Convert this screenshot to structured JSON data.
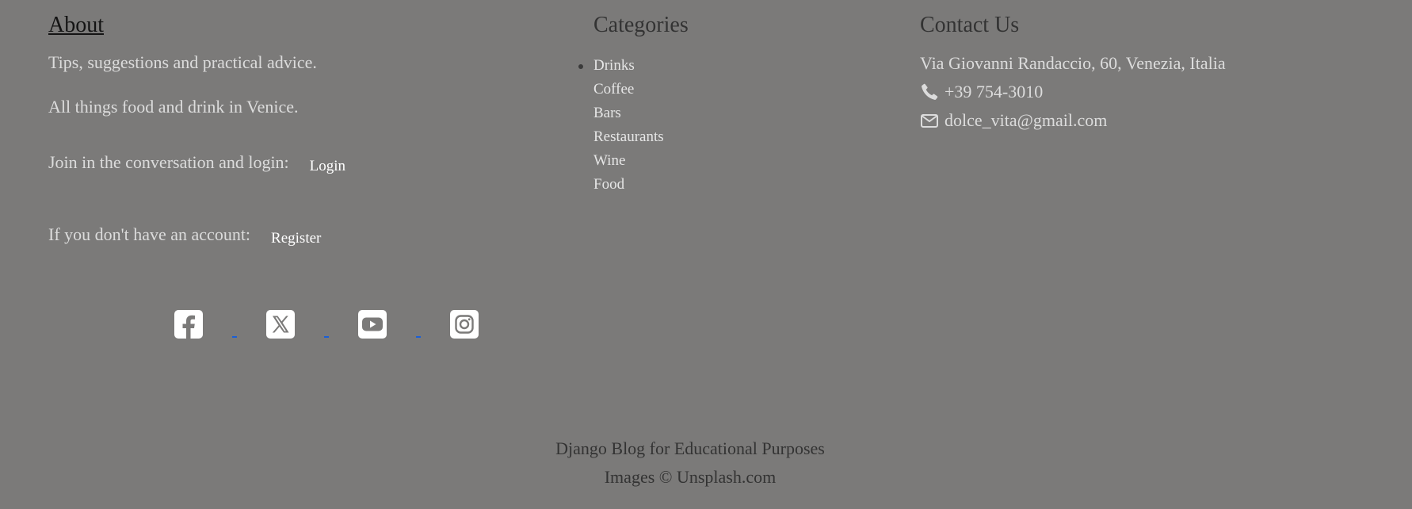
{
  "about": {
    "title": "About",
    "line1": "Tips, suggestions and practical advice.",
    "line2": "All things food and drink in Venice.",
    "login_prompt": "Join in the conversation and login:",
    "login_label": "Login",
    "register_prompt": "If you don't have an account:",
    "register_label": "Register"
  },
  "social": {
    "icons": [
      "facebook-icon",
      "x-twitter-icon",
      "youtube-icon",
      "instagram-icon"
    ],
    "icon_color": "#ffffff",
    "link_color": "#1a5fd6"
  },
  "categories": {
    "title": "Categories",
    "items": [
      "Drinks",
      "Coffee",
      "Bars",
      "Restaurants",
      "Wine",
      "Food"
    ]
  },
  "contact": {
    "title": "Contact Us",
    "address": "Via Giovanni Randaccio, 60, Venezia, Italia",
    "phone": "+39 754-3010",
    "email": "dolce_vita@gmail.com",
    "phone_icon": "phone-icon",
    "email_icon": "envelope-icon"
  },
  "credits": {
    "line1": "Django Blog for Educational Purposes",
    "line2": "Images © Unsplash.com"
  },
  "colors": {
    "background": "#7b7a79",
    "text_light": "#dcdcdc",
    "heading_dark": "#333333"
  }
}
